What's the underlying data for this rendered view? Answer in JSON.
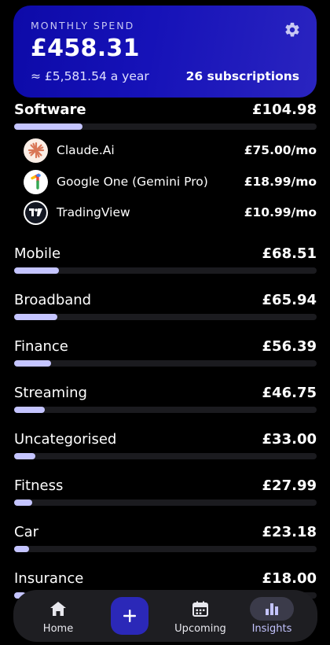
{
  "summary": {
    "label": "MONTHLY SPEND",
    "amount": "£458.31",
    "yearly": "≈ £5,581.54 a year",
    "count": "26 subscriptions"
  },
  "categories": [
    {
      "name": "Software",
      "total": "£104.98",
      "share": 0.227,
      "subscriptions": [
        {
          "name": "Claude.Ai",
          "price": "£75.00/mo",
          "icon": "claude-logo-icon"
        },
        {
          "name": "Google One (Gemini Pro)",
          "price": "£18.99/mo",
          "icon": "google-one-logo-icon"
        },
        {
          "name": "TradingView",
          "price": "£10.99/mo",
          "icon": "tradingview-logo-icon"
        }
      ]
    },
    {
      "name": "Mobile",
      "total": "£68.51",
      "share": 0.148
    },
    {
      "name": "Broadband",
      "total": "£65.94",
      "share": 0.143
    },
    {
      "name": "Finance",
      "total": "£56.39",
      "share": 0.122
    },
    {
      "name": "Streaming",
      "total": "£46.75",
      "share": 0.101
    },
    {
      "name": "Uncategorised",
      "total": "£33.00",
      "share": 0.071
    },
    {
      "name": "Fitness",
      "total": "£27.99",
      "share": 0.061
    },
    {
      "name": "Car",
      "total": "£23.18",
      "share": 0.05
    },
    {
      "name": "Insurance",
      "total": "£18.00",
      "share": 0.039
    }
  ],
  "nav": {
    "home": "Home",
    "upcoming": "Upcoming",
    "insights": "Insights",
    "active": "insights"
  },
  "colors": {
    "accent": "#c4c4ff",
    "card": "#1612b8",
    "track": "#1b1b1f",
    "add_button": "#2b28b8"
  }
}
